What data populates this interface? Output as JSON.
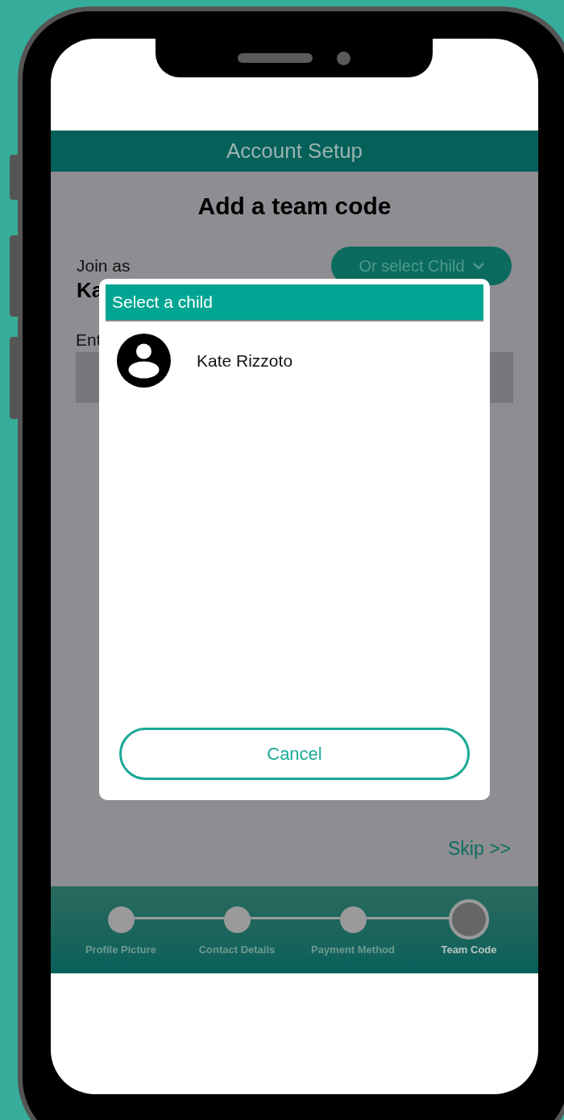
{
  "header": {
    "title": "Account Setup"
  },
  "page": {
    "title": "Add a team code",
    "join_label": "Join as",
    "join_name": "Ka",
    "select_child_button": "Or select Child",
    "code_label": "Ent",
    "skip_link": "Skip >>"
  },
  "dialog": {
    "title": "Select a child",
    "children": [
      {
        "name": "Kate Rizzoto"
      }
    ],
    "cancel_button": "Cancel"
  },
  "steps": [
    {
      "label": "Profile Picture",
      "selected": false
    },
    {
      "label": "Contact Details",
      "selected": false
    },
    {
      "label": "Payment Method",
      "selected": false
    },
    {
      "label": "Team Code",
      "selected": true
    }
  ]
}
